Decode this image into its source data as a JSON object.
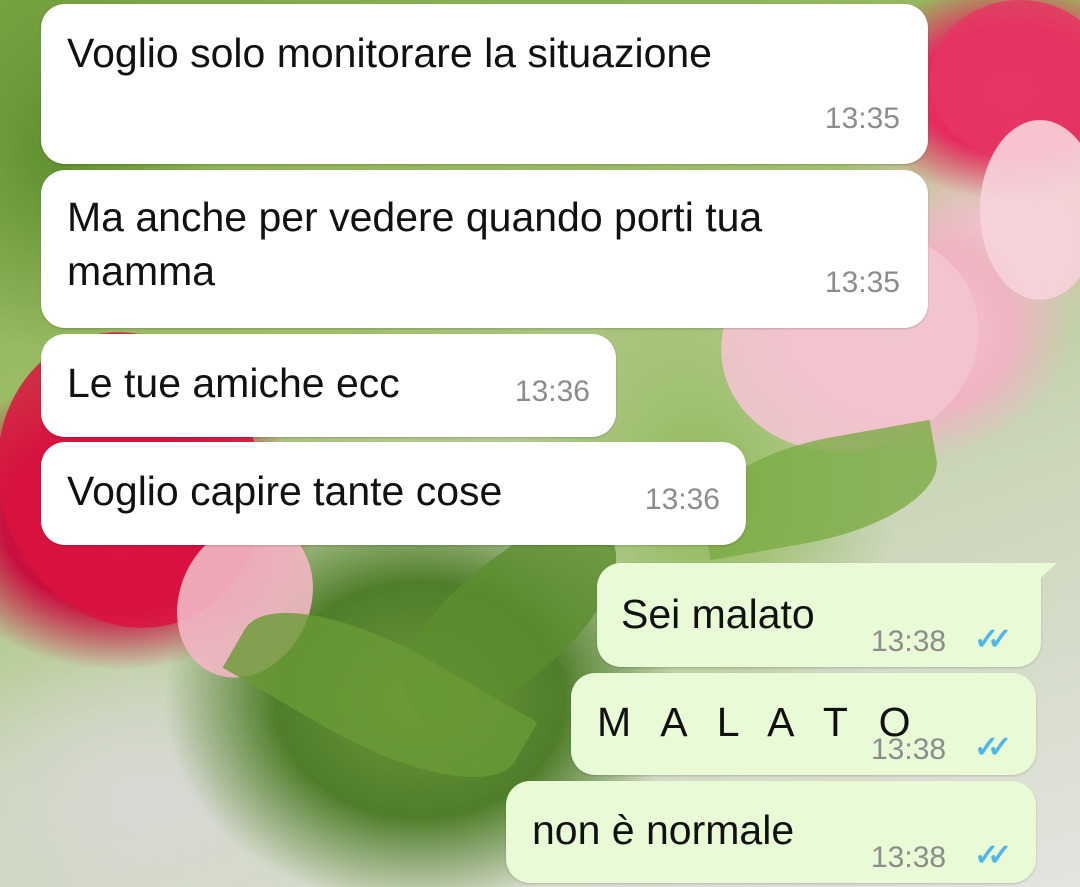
{
  "messages": [
    {
      "direction": "incoming",
      "text_lines": [
        "Voglio solo monitorare la situazione"
      ],
      "time": "13:35"
    },
    {
      "direction": "incoming",
      "text_lines": [
        "Ma anche per vedere quando porti tua",
        "mamma"
      ],
      "time": "13:35"
    },
    {
      "direction": "incoming",
      "text_lines": [
        "Le tue amiche ecc"
      ],
      "time": "13:36"
    },
    {
      "direction": "incoming",
      "text_lines": [
        "Voglio capire tante cose"
      ],
      "time": "13:36"
    },
    {
      "direction": "outgoing",
      "text_lines": [
        "Sei malato"
      ],
      "time": "13:38",
      "status_icon": "double-check-icon",
      "status_color": "#4fb6ec"
    },
    {
      "direction": "outgoing",
      "text_lines": [
        "M A L A T O"
      ],
      "time": "13:38",
      "status_icon": "double-check-icon",
      "status_color": "#4fb6ec"
    },
    {
      "direction": "outgoing",
      "text_lines": [
        "non è normale"
      ],
      "time": "13:38",
      "status_icon": "double-check-icon",
      "status_color": "#4fb6ec"
    }
  ],
  "colors": {
    "incoming_bubble": "#ffffff",
    "outgoing_bubble": "#e8fbd6",
    "timestamp": "#8c8c8c",
    "read_ticks": "#4fb6ec"
  }
}
